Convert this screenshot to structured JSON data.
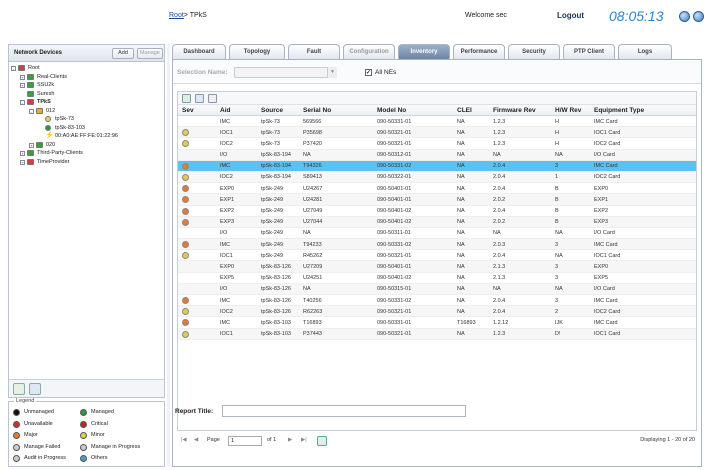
{
  "header": {
    "crumb_root": "Root",
    "crumb_sep": ">",
    "crumb_current": "TPkS",
    "welcome": "Welcome  sec",
    "logout": "Logout",
    "clock": "08:05:13"
  },
  "left_panel": {
    "title": "Network Devices",
    "add": "Add",
    "manage": "Manage",
    "tree": [
      {
        "label": "Root",
        "level": 0,
        "color": "#d04040",
        "exp": "-"
      },
      {
        "label": "Real-Clients",
        "level": 1,
        "color": "#3aa03a",
        "exp": "+"
      },
      {
        "label": "SSU2k",
        "level": 1,
        "color": "#3aa03a",
        "exp": "+"
      },
      {
        "label": "Suresh",
        "level": 1,
        "color": "#3aa03a",
        "exp": ""
      },
      {
        "label": "TPkS",
        "level": 1,
        "color": "#d04040",
        "exp": "-",
        "bold": true
      },
      {
        "label": "012",
        "level": 2,
        "color": "#e0b030",
        "exp": "-"
      },
      {
        "label": "tpSk-73",
        "level": 3,
        "color": "#e0d060",
        "exp": "",
        "dot": true
      },
      {
        "label": "tpSk-83-103",
        "level": 3,
        "color": "#2a9a2a",
        "exp": "",
        "dot": true
      },
      {
        "label": "00:A0:AE:FF:FE:01:22:96",
        "level": 3,
        "color": "#3aa03a",
        "exp": "",
        "bolt": true
      },
      {
        "label": "020",
        "level": 2,
        "color": "#3aa03a",
        "exp": "+"
      },
      {
        "label": "Third-Party-Clients",
        "level": 1,
        "color": "#3aa03a",
        "exp": "+"
      },
      {
        "label": "TimeProvider",
        "level": 1,
        "color": "#d04040",
        "exp": "+"
      }
    ]
  },
  "legend": {
    "title": "Legend",
    "items": [
      {
        "label": "Unmanaged",
        "color": "#111"
      },
      {
        "label": "Managed",
        "color": "#2a9a3a"
      },
      {
        "label": "Unavailable",
        "color": "#d03030"
      },
      {
        "label": "Critical",
        "color": "#cc2020"
      },
      {
        "label": "Major",
        "color": "#e87a30"
      },
      {
        "label": "Minor",
        "color": "#e0cc50"
      },
      {
        "label": "Manage Failed",
        "color": "#cccccc"
      },
      {
        "label": "Manage in Progress",
        "color": "#cccccc"
      },
      {
        "label": "Audit in Progress",
        "color": "#cccccc"
      },
      {
        "label": "Others",
        "color": "#4aa0c0"
      }
    ]
  },
  "tabs": [
    "Dashboard",
    "Topology",
    "Fault",
    "Configuration",
    "Inventory",
    "Performance",
    "Security",
    "PTP Client",
    "Logs"
  ],
  "selection": {
    "label": "Selection Name:",
    "all_nes": "All NEs",
    "all_nes_checked": "✓"
  },
  "grid": {
    "columns": [
      "Sev",
      "Aid",
      "Source",
      "Serial No",
      "Model No",
      "CLEI",
      "Firmware Rev",
      "H/W Rev",
      "Equipment Type"
    ],
    "rows": [
      {
        "sev": "",
        "c": [
          "IMC",
          "tpSk-73",
          "569566",
          "090-50331-01",
          "NA",
          "1.2.3",
          "H",
          "IMC Card"
        ]
      },
      {
        "sev": "#e0cc50",
        "c": [
          "IOC1",
          "tpSk-73",
          "P35698",
          "090-50321-01",
          "NA",
          "1.2.3",
          "H",
          "IOC1 Card"
        ]
      },
      {
        "sev": "#e0cc50",
        "c": [
          "IOC2",
          "tpSk-73",
          "P37420",
          "090-50321-01",
          "NA",
          "1.2.3",
          "H",
          "IOC2 Card"
        ]
      },
      {
        "sev": "",
        "c": [
          "I/O",
          "tpSk-83-194",
          "NA",
          "090-50312-01",
          "NA",
          "NA",
          "NA",
          "I/O Card"
        ]
      },
      {
        "sev": "#e87a30",
        "c": [
          "IMC",
          "tpSk-83-194",
          "T94326",
          "090-50331-02",
          "NA",
          "2.0.4",
          "3",
          "IMC Card"
        ],
        "sel": true
      },
      {
        "sev": "#e0cc50",
        "c": [
          "IOC2",
          "tpSk-83-194",
          "S89413",
          "090-50322-01",
          "NA",
          "2.0.4",
          "1",
          "IOC2 Card"
        ]
      },
      {
        "sev": "#e87a30",
        "c": [
          "EXP0",
          "tpSk-249",
          "U24267",
          "090-50401-01",
          "NA",
          "2.0.4",
          "B",
          "EXP0"
        ]
      },
      {
        "sev": "#e87a30",
        "c": [
          "EXP1",
          "tpSk-249",
          "U24281",
          "090-50401-01",
          "NA",
          "2.0.2",
          "B",
          "EXP1"
        ]
      },
      {
        "sev": "#e87a30",
        "c": [
          "EXP2",
          "tpSk-249",
          "U27049",
          "090-50401-02",
          "NA",
          "2.0.4",
          "B",
          "EXP2"
        ]
      },
      {
        "sev": "#e87a30",
        "c": [
          "EXP3",
          "tpSk-249",
          "U27044",
          "090-50401-02",
          "NA",
          "2.0.2",
          "B",
          "EXP3"
        ]
      },
      {
        "sev": "",
        "c": [
          "I/O",
          "tpSk-249",
          "NA",
          "090-50311-01",
          "NA",
          "NA",
          "NA",
          "I/O Card"
        ]
      },
      {
        "sev": "#e87a30",
        "c": [
          "IMC",
          "tpSk-249",
          "T94233",
          "090-50331-02",
          "NA",
          "2.0.3",
          "3",
          "IMC Card"
        ]
      },
      {
        "sev": "#e0cc50",
        "c": [
          "IOC1",
          "tpSk-249",
          "R45262",
          "090-50321-01",
          "NA",
          "2.0.4",
          "NA",
          "IOC1 Card"
        ]
      },
      {
        "sev": "",
        "c": [
          "EXP0",
          "tpSk-83-126",
          "U27209",
          "090-50401-01",
          "NA",
          "2.1.3",
          "3",
          "EXP0"
        ]
      },
      {
        "sev": "",
        "c": [
          "EXP5",
          "tpSk-83-126",
          "U24251",
          "090-50401-02",
          "NA",
          "2.1.3",
          "3",
          "EXP5"
        ]
      },
      {
        "sev": "",
        "c": [
          "I/O",
          "tpSk-83-126",
          "NA",
          "090-50315-01",
          "NA",
          "NA",
          "NA",
          "I/O Card"
        ]
      },
      {
        "sev": "#e87a30",
        "c": [
          "IMC",
          "tpSk-83-126",
          "T40256",
          "090-50331-02",
          "NA",
          "2.0.4",
          "3",
          "IMC Card"
        ]
      },
      {
        "sev": "#e0cc50",
        "c": [
          "IOC2",
          "tpSk-83-126",
          "R62263",
          "090-50321-01",
          "NA",
          "2.0.4",
          "2",
          "IOC2 Card"
        ]
      },
      {
        "sev": "#e87a30",
        "c": [
          "IMC",
          "tpSk-83-103",
          "T16893",
          "090-50331-01",
          "T16893",
          "1.2.12",
          "IJK",
          "IMC Card"
        ]
      },
      {
        "sev": "#e0cc50",
        "c": [
          "IOC1",
          "tpSk-83-103",
          "P37443",
          "090-50321-01",
          "NA",
          "1.2.3",
          "D!",
          "IOC1 Card"
        ]
      }
    ]
  },
  "pager": {
    "page_label": "Page",
    "page_value": "1",
    "of_label": "of 1",
    "display": "Displaying 1 - 20 of 20"
  },
  "report": {
    "label": "Report Title:"
  }
}
